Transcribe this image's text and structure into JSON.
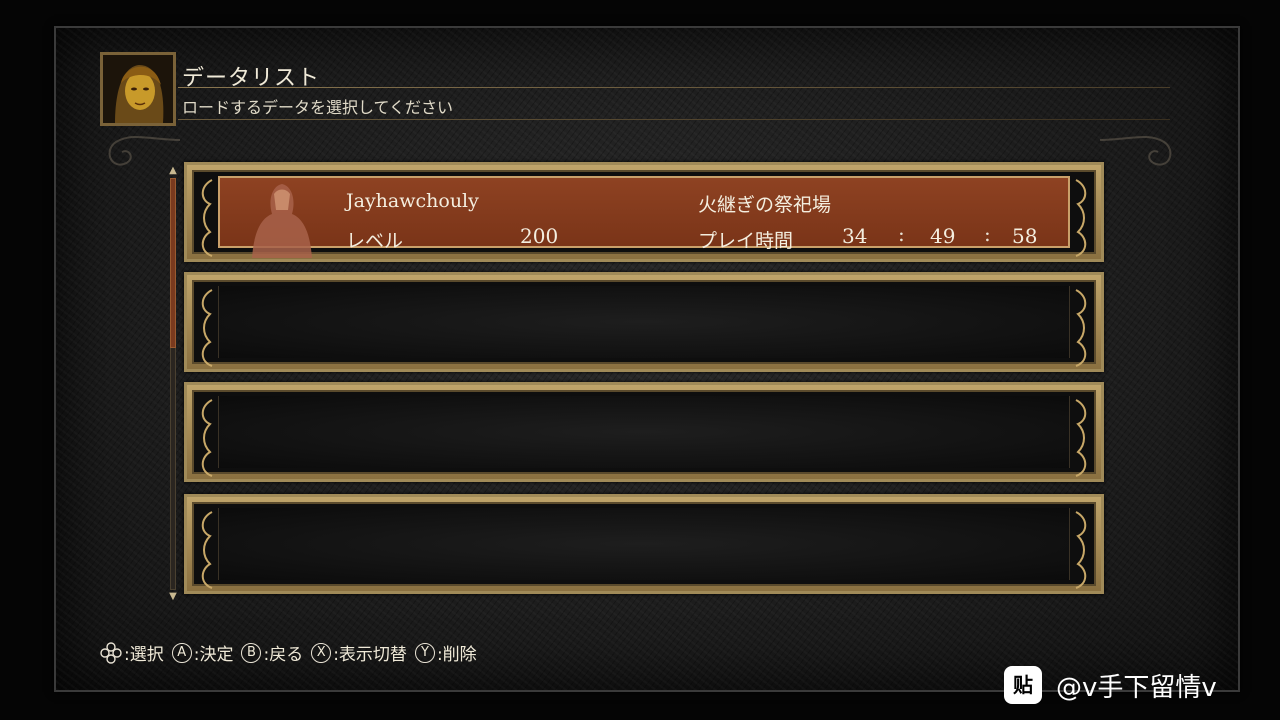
{
  "header": {
    "title": "データリスト",
    "subtitle": "ロードするデータを選択してください"
  },
  "slots": [
    {
      "name": "Jayhawchouly",
      "level_label": "レベル",
      "level": "200",
      "location": "火継ぎの祭祀場",
      "playtime_label": "プレイ時間",
      "hours": "34",
      "minutes": "49",
      "seconds": "58",
      "sep1": ":",
      "sep2": ":"
    }
  ],
  "controls": [
    {
      "icon": "dpad-icon",
      "label": ":選択"
    },
    {
      "button": "A",
      "label": ":決定"
    },
    {
      "button": "B",
      "label": ":戻る"
    },
    {
      "button": "X",
      "label": ":表示切替"
    },
    {
      "button": "Y",
      "label": ":削除"
    }
  ],
  "watermark": {
    "icon_text": "贴",
    "text": "@v手下留情v"
  },
  "colors": {
    "selected_slot": "#8e4222",
    "frame_gold": "#bfa46a",
    "scroll_thumb": "#7a3a1e"
  }
}
